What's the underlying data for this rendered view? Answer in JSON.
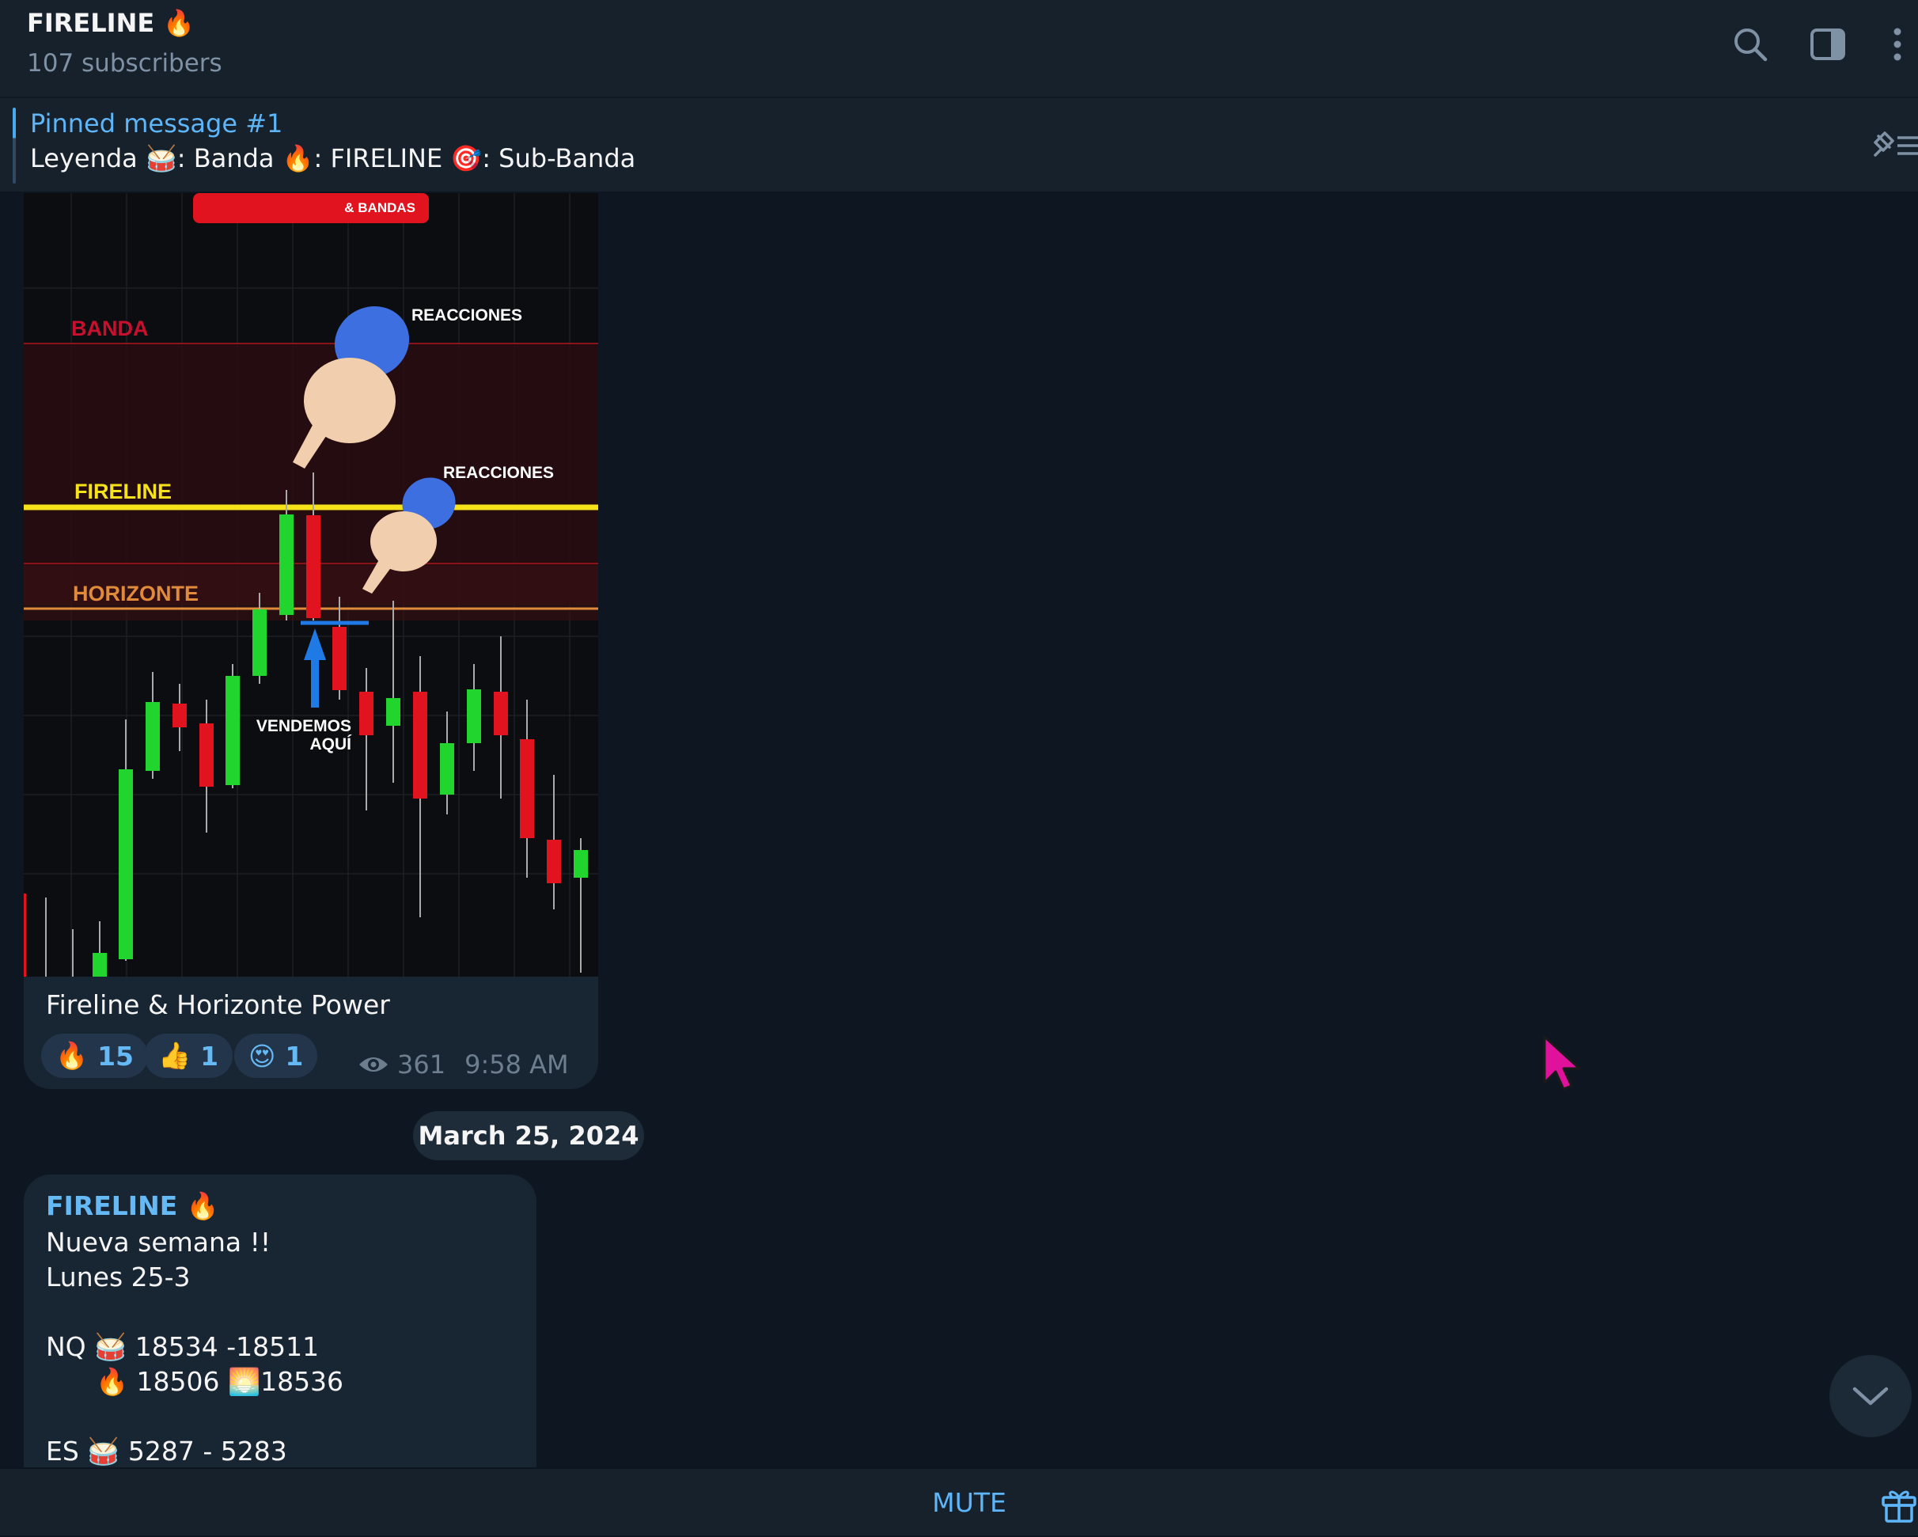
{
  "header": {
    "title": "FIRELINE 🔥",
    "subtitle": "107 subscribers"
  },
  "header_icons": [
    "search-icon",
    "sidebar-toggle-icon",
    "more-vertical-icon"
  ],
  "pinned": {
    "title": "Pinned message #1",
    "text": "Leyenda 🥁: Banda  🔥: FIRELINE  🎯: Sub-Banda"
  },
  "message1": {
    "image_labels": {
      "bandas": "& BANDAS",
      "banda": "BANDA",
      "fireline": "FIRELINE",
      "horizonte": "HORIZONTE",
      "reacciones_1": "REACCIONES",
      "reacciones_2": "REACCIONES",
      "vendemos": "VENDEMOS",
      "aqui": "AQUÍ"
    },
    "caption": "Fireline & Horizonte Power",
    "reactions": [
      {
        "emoji": "🔥",
        "count": "15"
      },
      {
        "emoji": "👍",
        "count": "1"
      },
      {
        "emoji": "😍",
        "count": "1"
      }
    ],
    "views": "361",
    "time": "9:58 AM"
  },
  "date_separator": "March 25, 2024",
  "message2": {
    "sender": "FIRELINE 🔥",
    "lines": [
      "Nueva semana !!",
      "Lunes 25-3",
      "",
      "NQ 🥁 18534 -18511",
      "      🔥 18506 🌅18536",
      "",
      "ES 🥁 5287 - 5283"
    ]
  },
  "footer": {
    "mute_label": "MUTE"
  },
  "colors": {
    "background": "#0e1621",
    "panel": "#17212b",
    "bubble": "#182533",
    "accent": "#5eb5f7",
    "bull_candle": "#22d42e",
    "bear_candle": "#e0131e",
    "fireline": "#f5e21a",
    "horizonte": "#e08a3c",
    "banda": "#c8102e"
  }
}
